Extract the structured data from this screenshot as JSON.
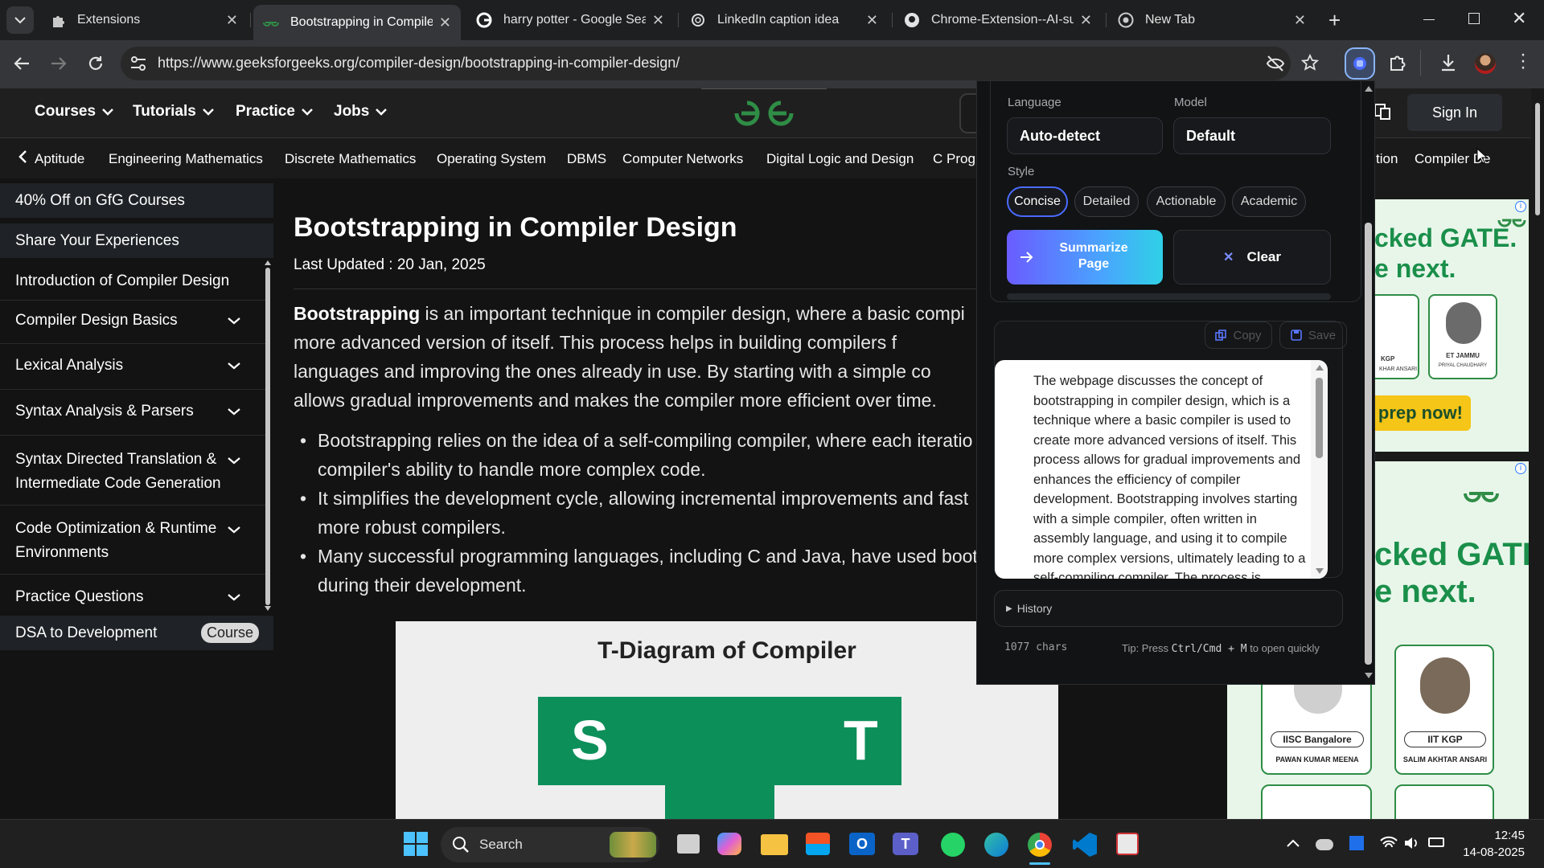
{
  "browser": {
    "tabs": [
      {
        "title": "Extensions",
        "active": false
      },
      {
        "title": "Bootstrapping in Compiler",
        "active": true
      },
      {
        "title": "harry potter - Google Sear",
        "active": false
      },
      {
        "title": "LinkedIn caption idea",
        "active": false
      },
      {
        "title": "Chrome-Extension--AI-sum",
        "active": false
      },
      {
        "title": "New Tab",
        "active": false
      }
    ],
    "url": "https://www.geeksforgeeks.org/compiler-design/bootstrapping-in-compiler-design/"
  },
  "site": {
    "nav": [
      "Courses",
      "Tutorials",
      "Practice",
      "Jobs"
    ],
    "sign_in": "Sign In",
    "subnav": [
      "Aptitude",
      "Engineering Mathematics",
      "Discrete Mathematics",
      "Operating System",
      "DBMS",
      "Computer Networks",
      "Digital Logic and Design",
      "C Progr",
      "tion",
      "Compiler De"
    ]
  },
  "sidebar": {
    "promo": "40% Off on GfG Courses",
    "share": "Share Your Experiences",
    "items": [
      {
        "label": "Introduction of Compiler Design"
      },
      {
        "label": "Compiler Design Basics"
      },
      {
        "label": "Lexical Analysis"
      },
      {
        "label": "Syntax Analysis & Parsers"
      },
      {
        "label": "Syntax Directed Translation &",
        "label2": "Intermediate Code Generation"
      },
      {
        "label": "Code Optimization & Runtime",
        "label2": "Environments"
      },
      {
        "label": "Practice Questions"
      }
    ],
    "dsa": "DSA to Development",
    "course_badge": "Course"
  },
  "article": {
    "title": "Bootstrapping in Compiler Design",
    "updated": "Last Updated : 20 Jan, 2025",
    "intro_bold": "Bootstrapping",
    "intro_l1": " is an important technique in compiler design, where a basic compi",
    "intro_l2": "more advanced version of itself. This process helps in building compilers f",
    "intro_l3": "languages and improving the ones already in use. By starting with a simple co",
    "intro_l4": "allows gradual improvements and makes the compiler more efficient over time.",
    "b1_l1": "Bootstrapping relies on the idea of a self-compiling compiler, where each iteratio",
    "b1_l2": "compiler's ability to handle more complex code.",
    "b2_l1": "It simplifies the development cycle, allowing incremental improvements and fast",
    "b2_l2": "more robust compilers.",
    "b3_l1": "Many successful programming languages, including C and Java, have used boots",
    "b3_l2": "during their development.",
    "figure_title": "T-Diagram of Compiler",
    "fig_s": "S",
    "fig_t": "T"
  },
  "panel": {
    "language_label": "Language",
    "model_label": "Model",
    "language_value": "Auto-detect",
    "model_value": "Default",
    "style_label": "Style",
    "styles": [
      "Concise",
      "Detailed",
      "Actionable",
      "Academic"
    ],
    "summarize": "Summarize\nPage",
    "summarize_l1": "Summarize",
    "summarize_l2": "Page",
    "clear": "Clear",
    "copy": "Copy",
    "save": "Save",
    "summary_lines": [
      "The webpage discusses the concept of",
      "bootstrapping in compiler design, which is a",
      "technique where a basic compiler is used to",
      "create more advanced versions of itself. This",
      "process allows for gradual improvements and",
      "enhances the efficiency of compiler",
      "development. Bootstrapping involves starting",
      "with a simple compiler, often written in",
      "assembly language, and using it to compile",
      "more complex versions, ultimately leading to a",
      "self-compiling compiler. The process is"
    ],
    "history": "History",
    "chars": "1077 chars",
    "tip_pre": "Tip: Press ",
    "tip_keys": "Ctrl/Cmd + M",
    "tip_post": " to open quickly"
  },
  "ads": {
    "line1": "cked GATE.",
    "line2": "e next.",
    "cta": "prep now!",
    "people": [
      {
        "name": "ET JAMMU",
        "sub": "PRIYAL CHAUDHARY"
      },
      {
        "name": "IISC Bangalore",
        "sub": "PAWAN KUMAR MEENA"
      },
      {
        "name": "IIT KGP",
        "sub": "SALIM AKHTAR ANSARI"
      }
    ],
    "left_frag": "KGP",
    "left_frag_sub": "KHAR ANSARI"
  },
  "taskbar": {
    "search": "Search",
    "time": "12:45",
    "date": "14-08-2025"
  },
  "colors": {
    "gfg_green": "#2f8d46",
    "accent_blue": "#4b6bff",
    "ad_green": "#e8f6ea"
  }
}
